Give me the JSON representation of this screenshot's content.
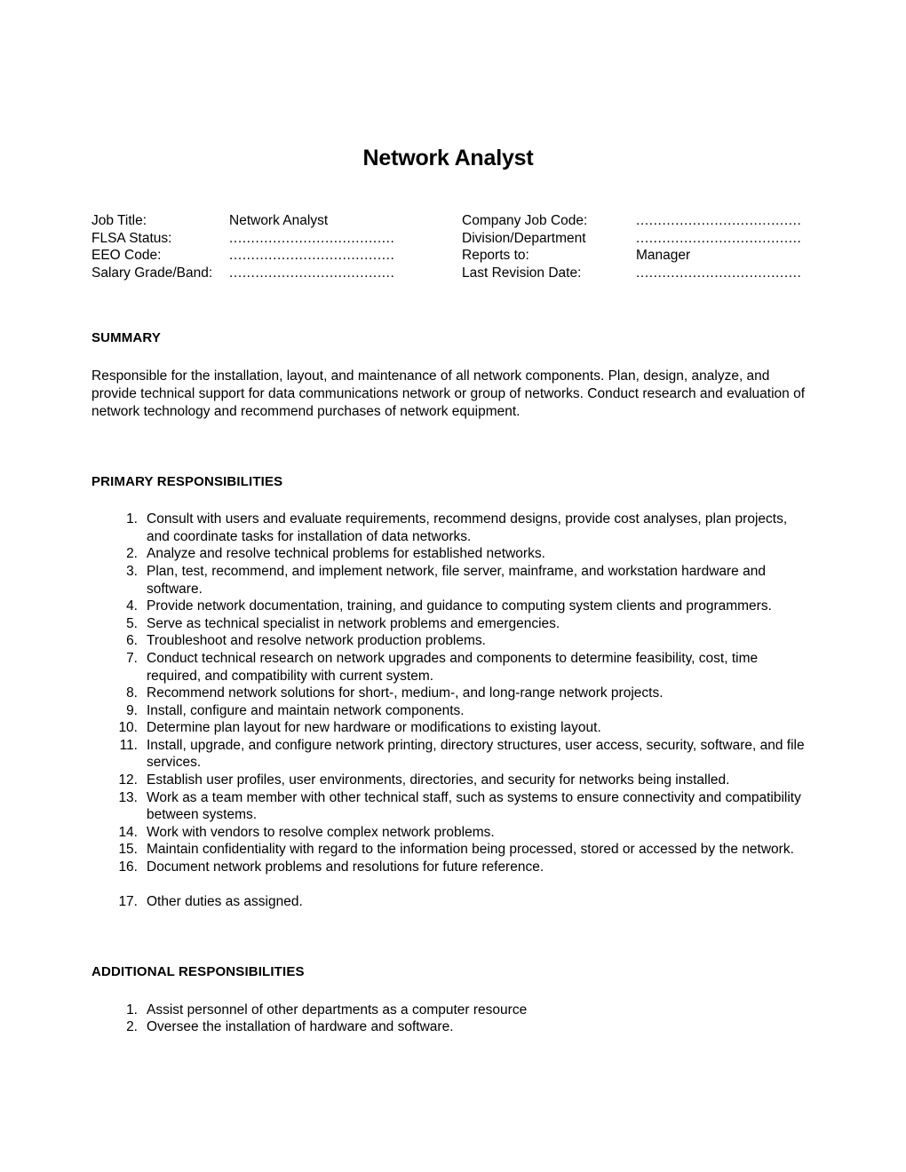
{
  "document": {
    "title": "Network Analyst",
    "dots_short": "......................................",
    "meta": {
      "rows": [
        {
          "left_label": "Job Title:",
          "left_value": "Network Analyst",
          "left_is_dots": false,
          "right_label": "Company Job Code:",
          "right_value": "......................................",
          "right_is_dots": true
        },
        {
          "left_label": "FLSA Status:",
          "left_value": "......................................",
          "left_is_dots": true,
          "right_label": "Division/Department",
          "right_value": "......................................",
          "right_is_dots": true
        },
        {
          "left_label": "EEO Code:",
          "left_value": "......................................",
          "left_is_dots": true,
          "right_label": "Reports to:",
          "right_value": "Manager",
          "right_is_dots": false
        },
        {
          "left_label": "Salary Grade/Band:",
          "left_value": "......................................",
          "left_is_dots": true,
          "right_label": "Last Revision Date:",
          "right_value": "......................................",
          "right_is_dots": true
        }
      ]
    },
    "summary": {
      "heading": "SUMMARY",
      "body": "Responsible for the installation, layout, and maintenance of all network components. Plan, design, analyze, and provide technical support for data communications network or group of networks. Conduct research and evaluation of network technology and recommend purchases of network equipment."
    },
    "primary_responsibilities": {
      "heading": "PRIMARY RESPONSIBILITIES",
      "items": [
        {
          "num": "1.",
          "text": "Consult with users and evaluate requirements, recommend designs, provide cost analyses, plan projects, and coordinate tasks for installation of data networks."
        },
        {
          "num": "2.",
          "text": "Analyze and resolve technical problems for established networks."
        },
        {
          "num": "3.",
          "text": "Plan, test, recommend, and implement network, file server, mainframe, and workstation hardware and software."
        },
        {
          "num": "4.",
          "text": "Provide network documentation, training, and guidance to computing system clients and programmers."
        },
        {
          "num": "5.",
          "text": "Serve as technical specialist in network problems and emergencies."
        },
        {
          "num": "6.",
          "text": "Troubleshoot and resolve network production problems."
        },
        {
          "num": "7.",
          "text": "Conduct technical research on network upgrades and components to determine feasibility, cost, time required, and compatibility with current system."
        },
        {
          "num": "8.",
          "text": "Recommend network solutions for short-, medium-, and long-range network projects."
        },
        {
          "num": "9.",
          "text": "Install, configure and maintain network components."
        },
        {
          "num": "10.",
          "text": "Determine plan layout for new hardware or modifications to existing layout."
        },
        {
          "num": "11.",
          "text": "Install, upgrade, and configure network printing, directory structures, user access, security, software, and file services."
        },
        {
          "num": "12.",
          "text": "Establish user profiles, user environments, directories, and security for networks being installed."
        },
        {
          "num": "13.",
          "text": "Work as a team member with other technical staff, such as systems to ensure connectivity and compatibility between systems."
        },
        {
          "num": "14.",
          "text": "Work with vendors to resolve complex network problems."
        },
        {
          "num": "15.",
          "text": "Maintain confidentiality with regard to the information being processed, stored or accessed by the network."
        },
        {
          "num": "16.",
          "text": "Document network problems and resolutions for future reference."
        },
        {
          "num": "17.",
          "text": "Other duties as assigned.",
          "gap_before": true
        }
      ]
    },
    "additional_responsibilities": {
      "heading": "ADDITIONAL RESPONSIBILITIES",
      "items": [
        {
          "num": "1.",
          "text": "Assist personnel of other departments as a computer resource"
        },
        {
          "num": "2.",
          "text": "Oversee the installation of hardware and software."
        }
      ]
    }
  }
}
